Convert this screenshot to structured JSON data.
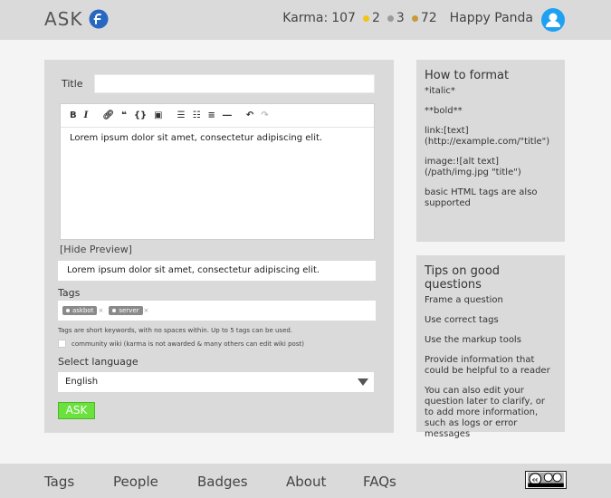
{
  "header": {
    "brand": "ASK",
    "karma_label": "Karma:",
    "karma_value": "107",
    "badges": {
      "gold": "2",
      "silver": "3",
      "bronze": "72"
    },
    "username": "Happy Panda"
  },
  "form": {
    "title_label": "Title",
    "editor_text": "Lorem ipsum dolor sit amet, consectetur adipiscing elit.",
    "hide_preview": "[Hide Preview]",
    "preview_text": "Lorem ipsum dolor sit amet, consectetur adipiscing elit.",
    "tags_label": "Tags",
    "tags": [
      "askbot",
      "server"
    ],
    "tags_help": "Tags are short keywords, with no spaces within. Up to 5 tags can be used.",
    "wiki_label": "community wiki (karma is not awarded & many others can edit wiki post)",
    "language_label": "Select language",
    "language_value": "English",
    "ask_button": "ASK"
  },
  "format_help": {
    "title": "How to format",
    "items": [
      "*italic*",
      "**bold**",
      "link:[text](http://example.com/\"title\")",
      "image:![alt text](/path/img.jpg \"title\")",
      "basic HTML tags are also supported"
    ]
  },
  "tips": {
    "title": "Tips on good questions",
    "items": [
      "Frame a question",
      "Use correct tags",
      "Use the markup tools",
      "Provide information that could be helpful to a reader",
      "You can also edit your question later to clarify, or to add more information, such as logs or error messages"
    ]
  },
  "footer": {
    "links": [
      "Tags",
      "People",
      "Badges",
      "About",
      "FAQs"
    ]
  },
  "colors": {
    "accent_button": "#6be13e",
    "avatar": "#1ea1f2",
    "logo": "#2767c2"
  }
}
